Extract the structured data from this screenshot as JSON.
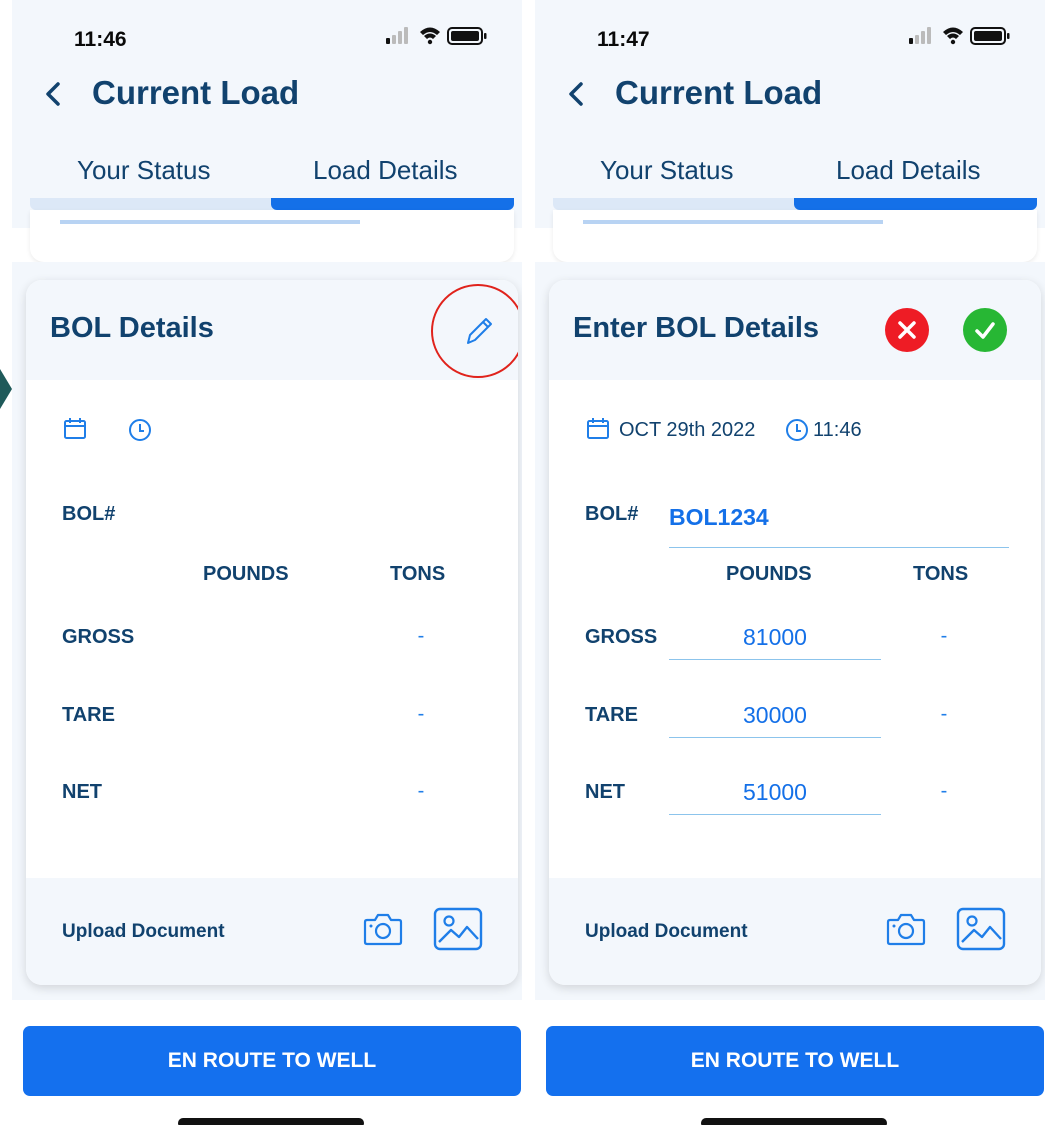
{
  "left": {
    "status_bar": {
      "time": "11:46"
    },
    "header": {
      "title": "Current Load"
    },
    "tabs": [
      {
        "label": "Your Status"
      },
      {
        "label": "Load Details",
        "active": true
      }
    ],
    "card": {
      "title": "BOL Details",
      "bol_label": "BOL#",
      "col_pounds": "POUNDS",
      "col_tons": "TONS",
      "rows": [
        {
          "label": "GROSS",
          "tons": "-"
        },
        {
          "label": "TARE",
          "tons": "-"
        },
        {
          "label": "NET",
          "tons": "-"
        }
      ],
      "upload_label": "Upload Document"
    },
    "action_button": "EN ROUTE TO WELL"
  },
  "right": {
    "status_bar": {
      "time": "11:47"
    },
    "header": {
      "title": "Current Load"
    },
    "tabs": [
      {
        "label": "Your Status"
      },
      {
        "label": "Load Details",
        "active": true
      }
    ],
    "card": {
      "title": "Enter BOL Details",
      "date": "OCT 29th 2022",
      "time": "11:46",
      "bol_label": "BOL#",
      "bol_value": "BOL1234",
      "col_pounds": "POUNDS",
      "col_tons": "TONS",
      "rows": [
        {
          "label": "GROSS",
          "pounds": "81000",
          "tons": "-"
        },
        {
          "label": "TARE",
          "pounds": "30000",
          "tons": "-"
        },
        {
          "label": "NET",
          "pounds": "51000",
          "tons": "-"
        }
      ],
      "upload_label": "Upload Document"
    },
    "action_button": "EN ROUTE TO WELL"
  },
  "colors": {
    "navy": "#11426e",
    "accent_blue": "#1470e8",
    "header_bg": "#f3f7fc",
    "cancel_red": "#ee1c25",
    "confirm_green": "#27b734",
    "highlight_ring": "#e0231c"
  },
  "icons": [
    "chevron-left-icon",
    "signal-icon",
    "wifi-icon",
    "battery-icon",
    "pencil-icon",
    "close-icon",
    "check-icon",
    "calendar-icon",
    "clock-icon",
    "camera-icon",
    "image-icon"
  ]
}
